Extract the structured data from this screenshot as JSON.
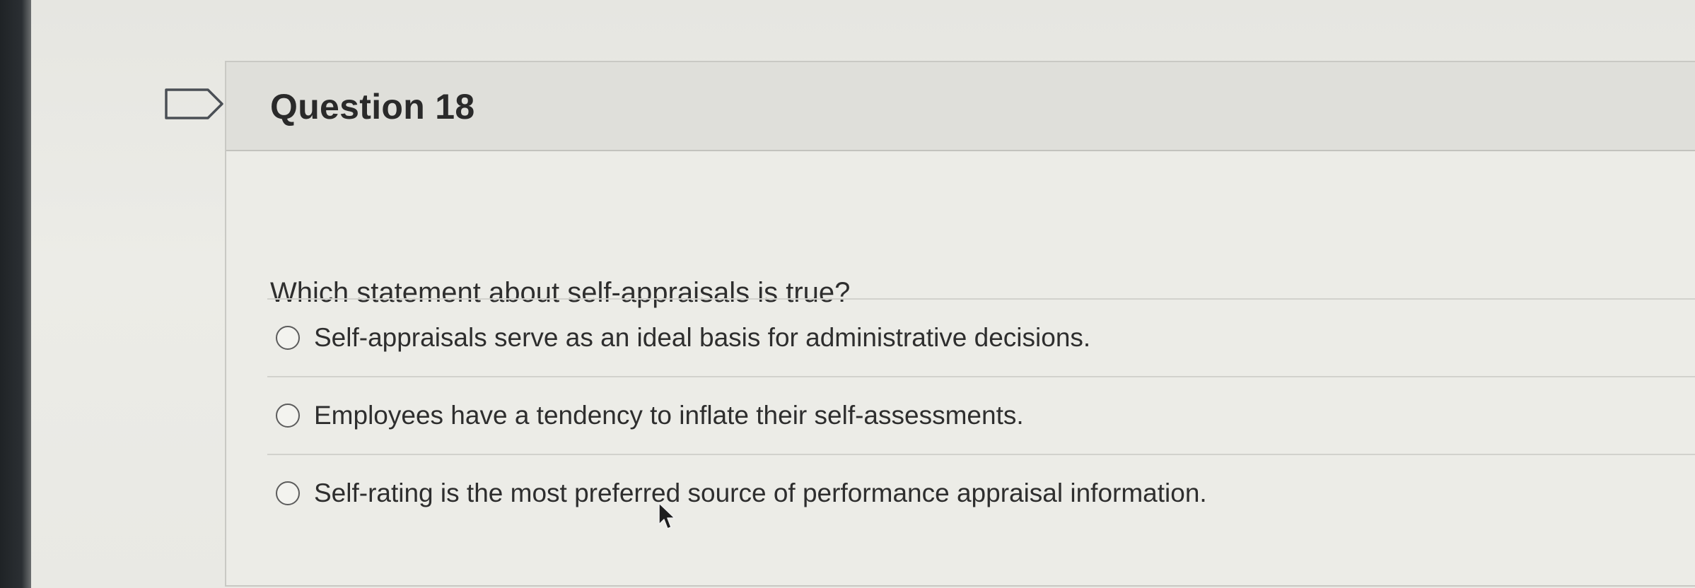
{
  "question": {
    "title": "Question 18",
    "prompt": "Which statement about self-appraisals is true?",
    "options": [
      {
        "label": "Self-appraisals serve as an ideal basis for administrative decisions.",
        "selected": false
      },
      {
        "label": "Employees have a tendency to inflate their self-assessments.",
        "selected": false
      },
      {
        "label": "Self-rating is the most preferred source of performance appraisal information.",
        "selected": false
      }
    ]
  },
  "icons": {
    "flag": "flag-question-icon",
    "cursor": "mouse-pointer-icon"
  },
  "colors": {
    "background": "#e8e8e3",
    "header": "#dfdfda",
    "text": "#2e2e2e"
  }
}
